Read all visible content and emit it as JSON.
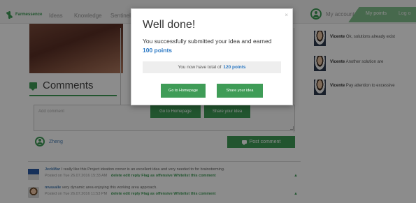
{
  "topbar": {
    "logo_text": "Farmessence",
    "nav": [
      "Ideas",
      "Knowledge",
      "Sentinel"
    ],
    "account_label": "My account",
    "points_label": "My points",
    "logout_label": "Log o"
  },
  "comments": {
    "title": "Comments",
    "placeholder": "Add comment",
    "ghost_home": "Go to Homepage",
    "ghost_share": "Share your idea",
    "current_user": "Zheng",
    "post_label": "Post comment"
  },
  "comment_list": [
    {
      "author": "JeckMar",
      "text": "I really like this Project ideation corner is an excellent idea and very needed to for brainstorming.",
      "posted": "Posted on Tue 26.07.2016 15:33 AM",
      "actions": "delete  edit  reply  Flag as offensive  Whitelist this comment"
    },
    {
      "author": "mvasalle",
      "text": "very dynamic area enjoying this working area approach.",
      "posted": "Posted on Tue 26.07.2016 11:53 PM",
      "actions": "delete  edit  reply  Flag as offensive  Whitelist this comment"
    }
  ],
  "sidebar": [
    {
      "name": "Vicente",
      "text": "Ok, solutions already exist"
    },
    {
      "name": "Vicente",
      "text": "Another solution are"
    },
    {
      "name": "Vicente",
      "text": "Pay attention to excessive"
    }
  ],
  "modal": {
    "title": "Well done!",
    "msg_prefix": "You successfully submitted your idea and earned",
    "points_earned": "100 points",
    "total_prefix": "You now have total of",
    "total_points": "120 points",
    "home_button": "Go to Homepage",
    "share_button": "Share your idea",
    "close": "×"
  },
  "colors": {
    "brand_green": "#3f9c57",
    "link_blue": "#2a78c4"
  }
}
